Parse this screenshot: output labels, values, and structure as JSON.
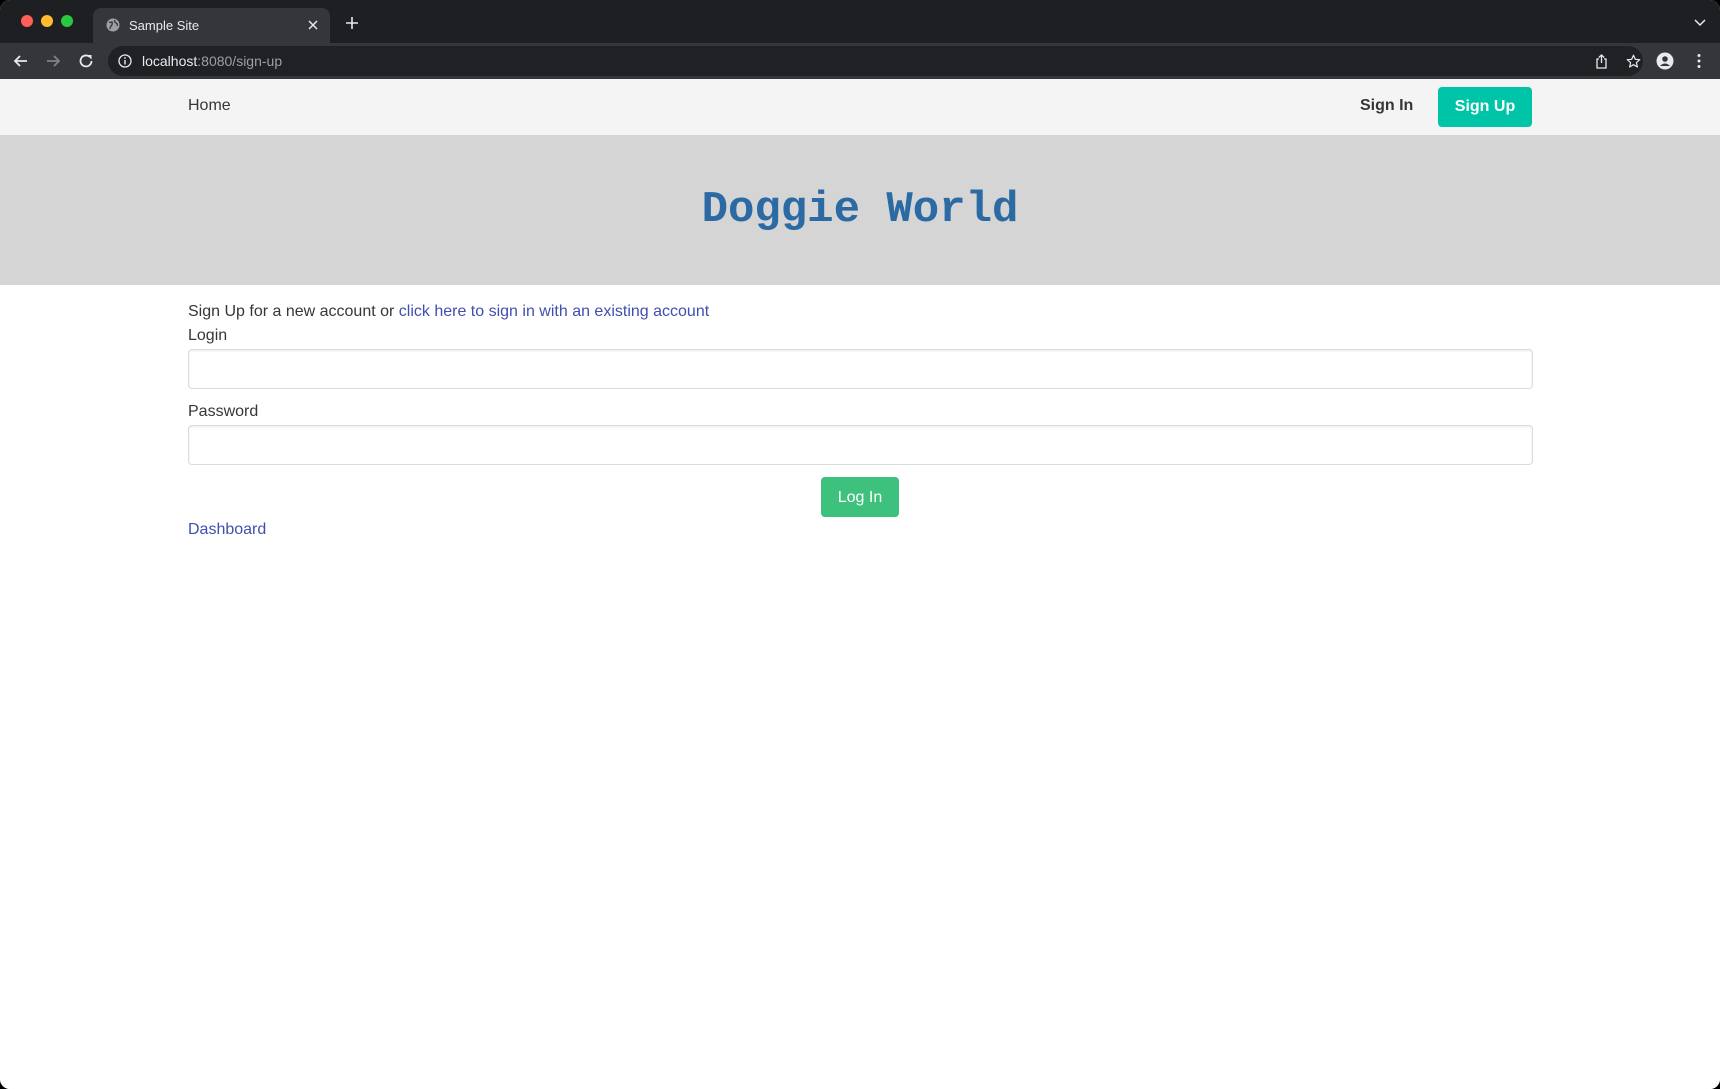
{
  "browser": {
    "tab_title": "Sample Site",
    "url_host": "localhost",
    "url_path": ":8080/sign-up"
  },
  "navbar": {
    "home_label": "Home",
    "signin_label": "Sign In",
    "signup_label": "Sign Up"
  },
  "hero": {
    "title": "Doggie World"
  },
  "form": {
    "intro_text": "Sign Up for a new account or ",
    "signin_link": "click here to sign in with an existing account",
    "login_label": "Login",
    "login_value": "",
    "password_label": "Password",
    "password_value": "",
    "submit_label": "Log In"
  },
  "footer": {
    "dashboard_link": "Dashboard"
  },
  "colors": {
    "signup_button": "#00c4a7",
    "login_button": "#3ec17c",
    "hero_title": "#2b6aa3",
    "link": "#3f4fae"
  },
  "icons": {
    "favicon": "globe-icon",
    "tab_close": "close-icon",
    "new_tab": "plus-icon",
    "back": "back-arrow-icon",
    "forward": "forward-arrow-icon",
    "reload": "reload-icon",
    "site_info": "info-icon",
    "share": "share-icon",
    "bookmark": "star-icon",
    "profile": "profile-icon",
    "menu": "kebab-menu-icon",
    "tab_list": "chevron-down-icon"
  }
}
